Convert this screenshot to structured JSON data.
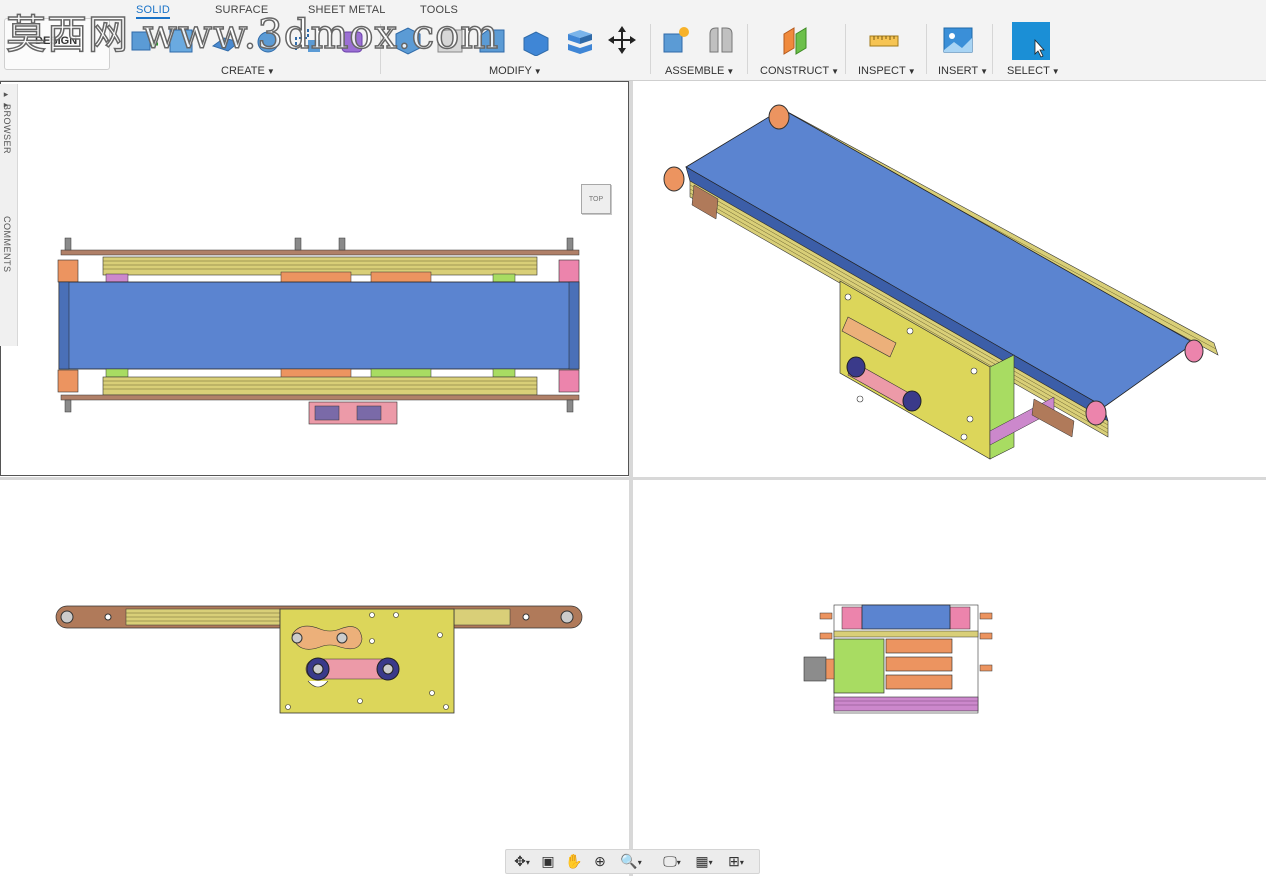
{
  "watermark": "莫西网 www.3dmox.com",
  "workspace": {
    "label": "DESIGN"
  },
  "tabs": [
    {
      "label": "SOLID",
      "active": true
    },
    {
      "label": "SURFACE",
      "active": false
    },
    {
      "label": "SHEET METAL",
      "active": false
    },
    {
      "label": "TOOLS",
      "active": false
    }
  ],
  "groups": {
    "create": "CREATE",
    "modify": "MODIFY",
    "assemble": "ASSEMBLE",
    "construct": "CONSTRUCT",
    "inspect": "INSPECT",
    "insert": "INSERT",
    "select": "SELECT"
  },
  "side_panel": {
    "browser": "BROWSER",
    "comments": "COMMENTS"
  },
  "viewcube": {
    "face": "TOP"
  },
  "colors": {
    "belt": "#5b84d0",
    "frame": "#d9cf78",
    "plate": "#dcd65a",
    "roller_orange": "#ec9460",
    "roller_pink": "#ec84ac",
    "green": "#a8dc62",
    "purple": "#cc88cc",
    "active_select": "#1b8fd6"
  }
}
